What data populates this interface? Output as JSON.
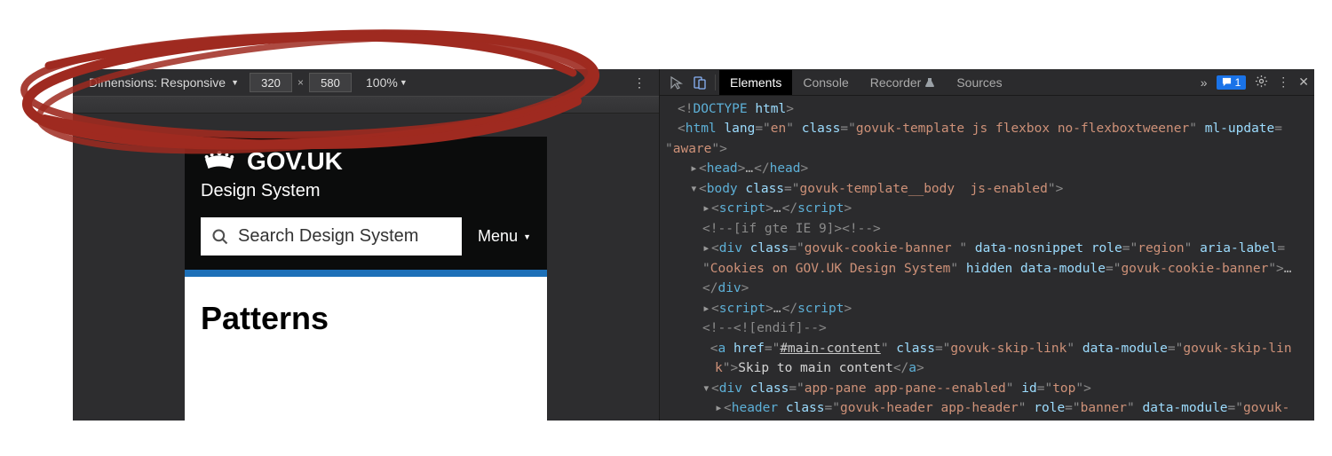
{
  "device_bar": {
    "dimensions_label": "Dimensions: Responsive",
    "width": "320",
    "height": "580",
    "zoom": "100%"
  },
  "govuk": {
    "brand": "GOV.UK",
    "subtitle": "Design System",
    "search_placeholder": "Search Design System",
    "menu_label": "Menu",
    "page_heading": "Patterns"
  },
  "tabs": {
    "elements": "Elements",
    "console": "Console",
    "recorder": "Recorder",
    "sources": "Sources",
    "issues_count": "1"
  },
  "dom": {
    "l0_doctype": "<!DOCTYPE html>",
    "l1_html_open": {
      "tag": "html",
      "attrs": [
        [
          "lang",
          "en"
        ],
        [
          "class",
          "govuk-template js flexbox no-flexboxtweener"
        ],
        [
          "ml-update",
          ""
        ]
      ]
    },
    "l1b_aware": "aware",
    "l2_head": {
      "tag": "head"
    },
    "l3_body_open": {
      "tag": "body",
      "attrs": [
        [
          "class",
          "govuk-template__body  js-enabled"
        ]
      ]
    },
    "l4_script": {
      "tag": "script"
    },
    "l5_comment": "[if gte IE 9]><!",
    "l6_cookie": {
      "tag": "div",
      "attrs": [
        [
          "class",
          "govuk-cookie-banner "
        ],
        [
          "data-nosnippet",
          ""
        ],
        [
          "role",
          "region"
        ],
        [
          "aria-label",
          ""
        ]
      ]
    },
    "l6b_cookie_label": "Cookies on GOV.UK Design System",
    "l6c_cookie_attrs": [
      [
        "hidden",
        ""
      ],
      [
        "data-module",
        "govuk-cookie-banner"
      ]
    ],
    "l7_script2": {
      "tag": "script"
    },
    "l8_endif": "<![endif]",
    "l9_a": {
      "tag": "a",
      "attrs": [
        [
          "href",
          "#main-content"
        ],
        [
          "class",
          "govuk-skip-link"
        ],
        [
          "data-module",
          "govuk-skip-lin"
        ]
      ],
      "suffix": "k",
      "text": "Skip to main content"
    },
    "l10_pane": {
      "tag": "div",
      "attrs": [
        [
          "class",
          "app-pane app-pane--enabled"
        ],
        [
          "id",
          "top"
        ]
      ]
    },
    "l11_header": {
      "tag": "header",
      "attrs": [
        [
          "class",
          "govuk-header app-header"
        ],
        [
          "role",
          "banner"
        ],
        [
          "data-module",
          "govuk-"
        ]
      ]
    }
  }
}
